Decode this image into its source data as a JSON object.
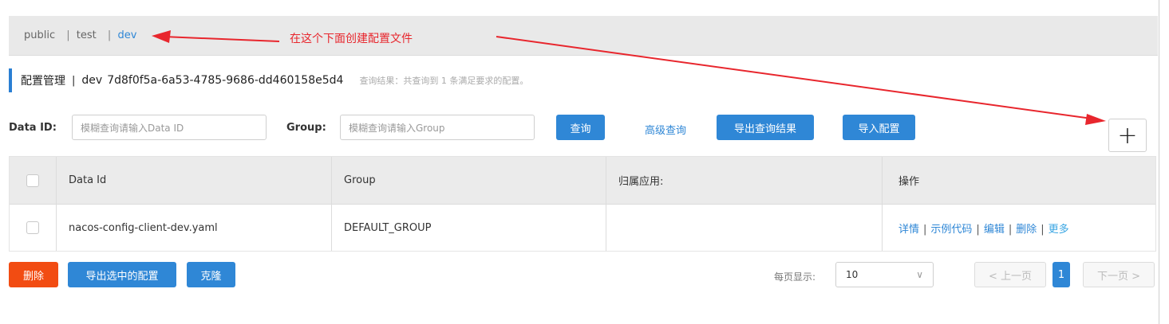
{
  "namespaces": {
    "items": [
      {
        "label": "public"
      },
      {
        "label": "test"
      },
      {
        "label": "dev"
      }
    ],
    "separator": "|"
  },
  "annotation": {
    "text": "在这个下面创建配置文件",
    "color": "#e8262d"
  },
  "page": {
    "title": "配置管理",
    "separator": "|",
    "namespace": "dev",
    "namespace_id": "7d8f0f5a-6a53-4785-9686-dd460158e5d4",
    "summary": "查询结果：共查询到 1 条满足要求的配置。"
  },
  "search": {
    "data_id_label": "Data ID:",
    "data_id_placeholder": "模糊查询请输入Data ID",
    "group_label": "Group:",
    "group_placeholder": "模糊查询请输入Group",
    "query_button": "查询",
    "advanced_link": "高级查询",
    "export_results_button": "导出查询结果",
    "import_button": "导入配置",
    "add_button": "+"
  },
  "table": {
    "columns": [
      "Data Id",
      "Group",
      "归属应用:",
      "操作"
    ],
    "rows": [
      {
        "data_id": "nacos-config-client-dev.yaml",
        "group": "DEFAULT_GROUP",
        "app": "",
        "actions": [
          "详情",
          "示例代码",
          "编辑",
          "删除",
          "更多"
        ]
      }
    ],
    "action_separator": "|"
  },
  "footer": {
    "delete_button": "删除",
    "export_selected_button": "导出选中的配置",
    "clone_button": "克隆",
    "page_size_label": "每页显示:",
    "page_size_value": "10",
    "prev_button": "< 上一页",
    "current_page": "1",
    "next_button": "下一页 >"
  },
  "colors": {
    "accent": "#2f87d6",
    "danger": "#f24c12",
    "annotation": "#e8262d"
  }
}
